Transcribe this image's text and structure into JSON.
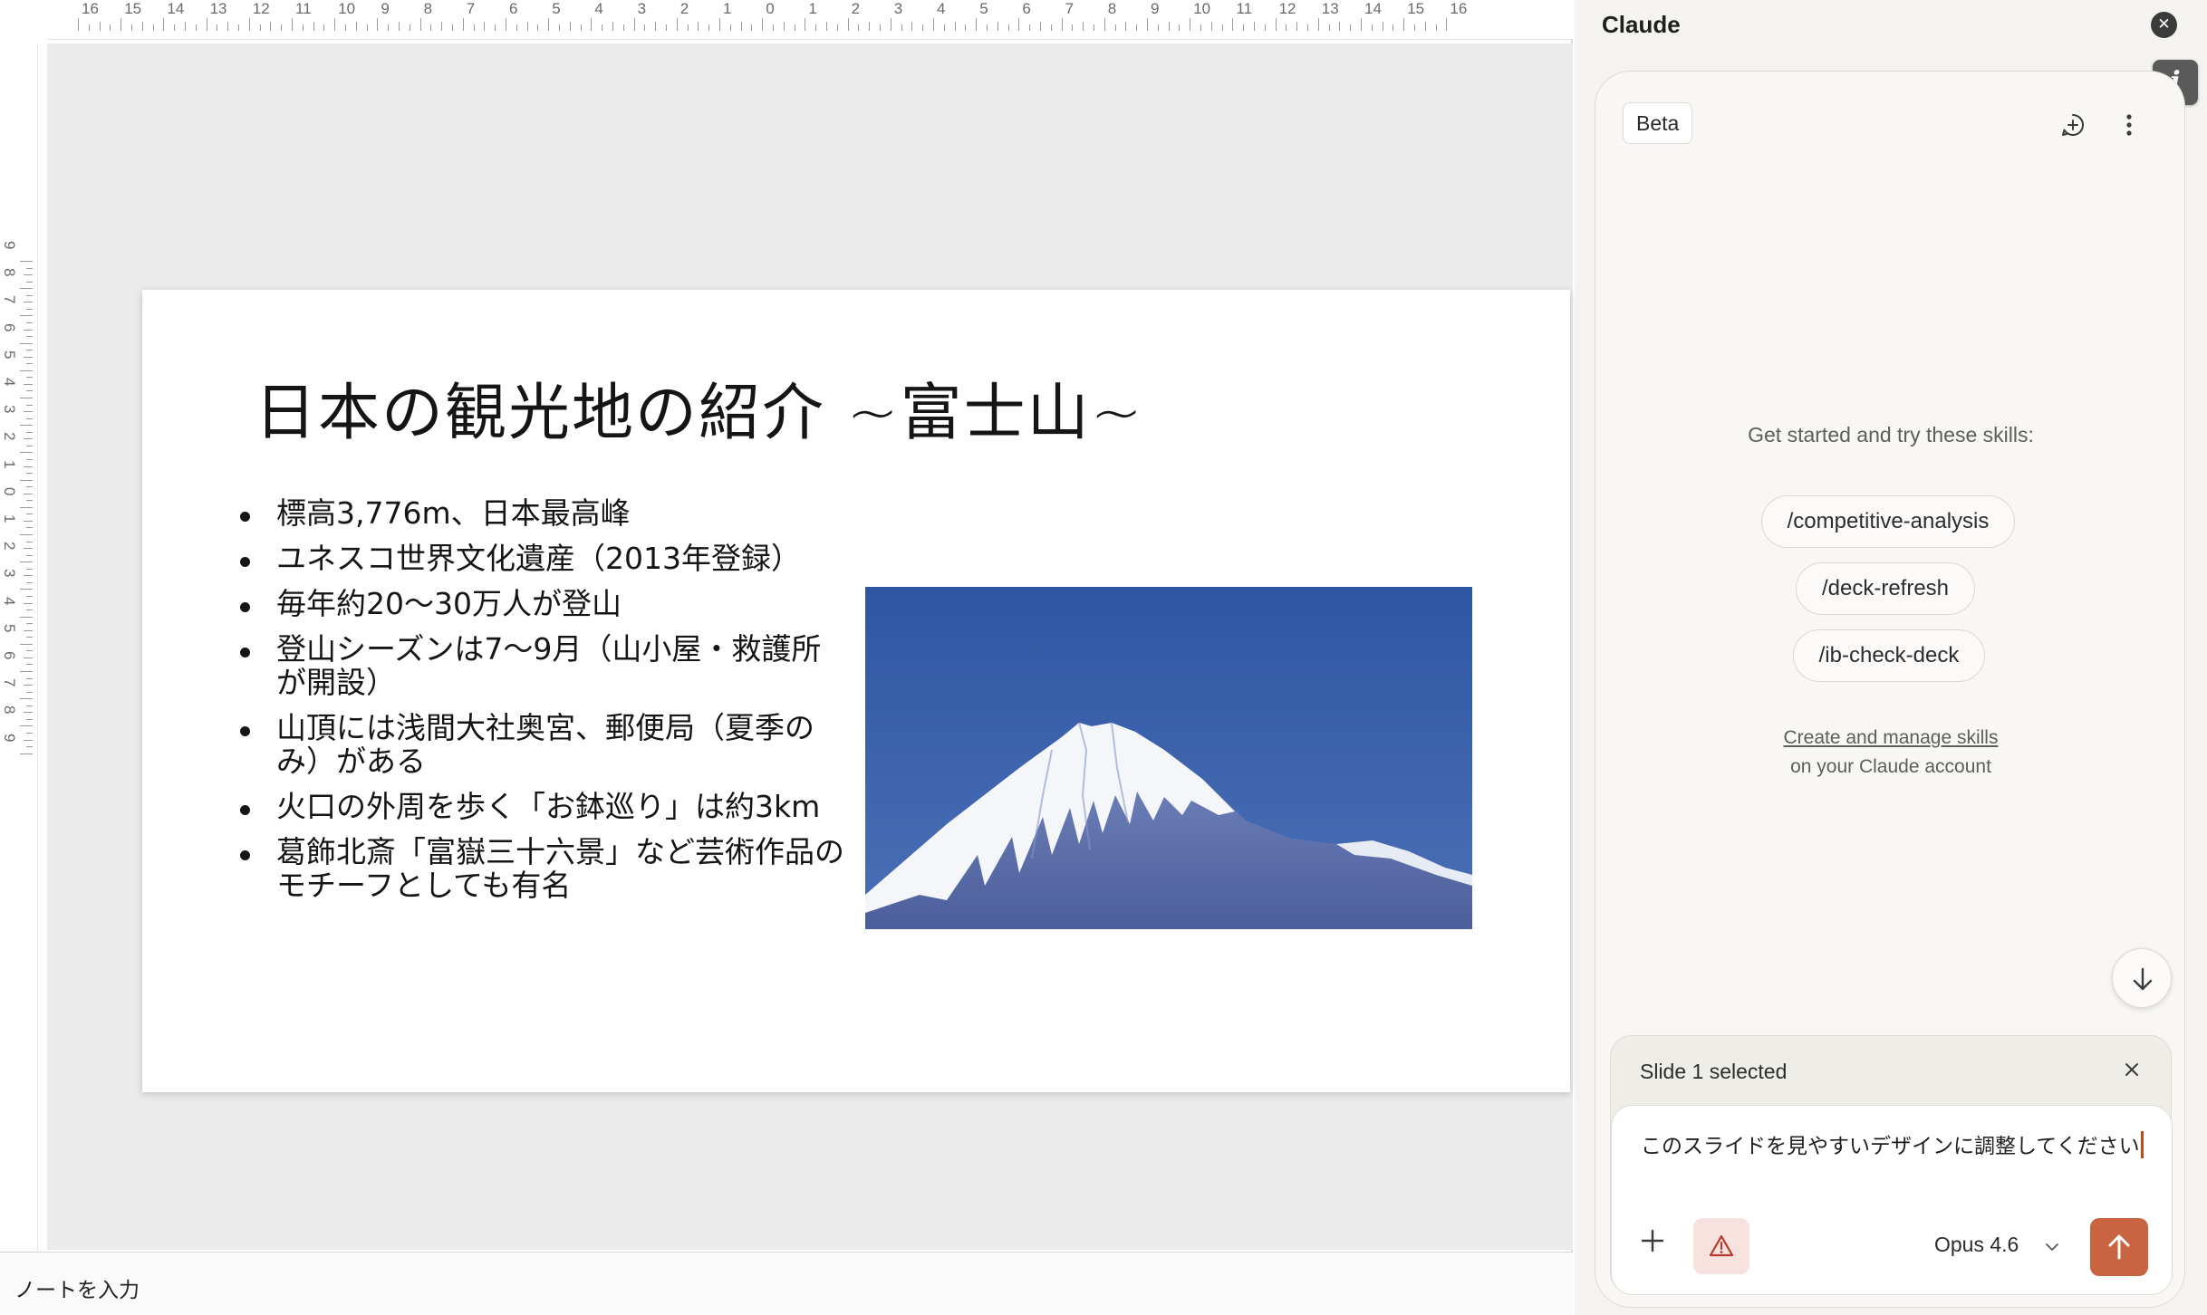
{
  "editor": {
    "ruler": {
      "horizontal_labels": [
        "16",
        "15",
        "14",
        "13",
        "12",
        "11",
        "10",
        "9",
        "8",
        "7",
        "6",
        "5",
        "4",
        "3",
        "2",
        "1",
        "0",
        "1",
        "2",
        "3",
        "4",
        "5",
        "6",
        "7",
        "8",
        "9",
        "10",
        "11",
        "12",
        "13",
        "14",
        "15",
        "16"
      ],
      "vertical_labels": [
        "9",
        "8",
        "7",
        "6",
        "5",
        "4",
        "3",
        "2",
        "1",
        "0",
        "1",
        "2",
        "3",
        "4",
        "5",
        "6",
        "7",
        "8",
        "9"
      ]
    },
    "slide": {
      "title": "日本の観光地の紹介 ~富士山~",
      "bullets": [
        "標高3,776m、日本最高峰",
        "ユネスコ世界文化遺産（2013年登録）",
        "毎年約20〜30万人が登山",
        "登山シーズンは7〜9月（山小屋・救護所が開設）",
        "山頂には浅間大社奥宮、郵便局（夏季のみ）がある",
        "火口の外周を歩く「お鉢巡り」は約3km",
        "葛飾北斎「富嶽三十六景」など芸術作品のモチーフとしても有名"
      ],
      "image_icon": "mount-fuji-photo",
      "colors": {
        "sky": "#3a63ad",
        "snow": "#f4f6fa",
        "rock": "#5b6ea8"
      }
    },
    "notes_placeholder": "ノートを入力"
  },
  "panel": {
    "title": "Claude",
    "close_icon": "close-circle-icon",
    "info_icon": "info-icon",
    "badge": "Beta",
    "new_chat_icon": "new-chat-icon",
    "more_icon": "more-vertical-icon",
    "skills_heading": "Get started and try these skills:",
    "skills": [
      "/competitive-analysis",
      "/deck-refresh",
      "/ib-check-deck"
    ],
    "manage_link": "Create and manage skills",
    "manage_sub": "on your Claude account",
    "scroll_icon": "arrow-down-icon",
    "context_chip": "Slide 1 selected",
    "prompt": "このスライドを見やすいデザインに調整してください",
    "model": "Opus 4.6",
    "accent": "#c96442",
    "warn_color": "#f7e2e0"
  }
}
